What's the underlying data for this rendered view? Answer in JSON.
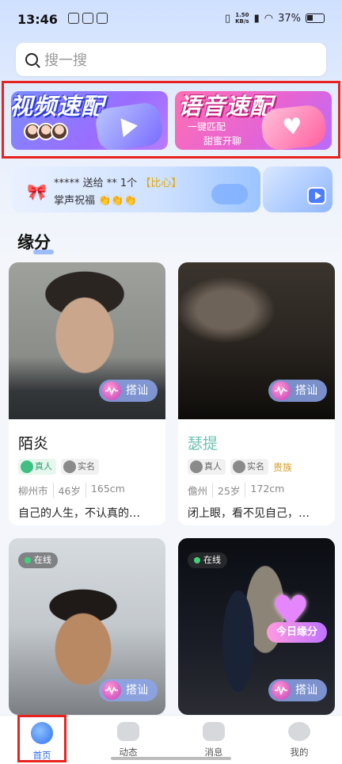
{
  "status_bar": {
    "time": "13:46",
    "net_speed": "1.50\nKB/s",
    "battery": "37%"
  },
  "search": {
    "placeholder": "搜一搜"
  },
  "banners": {
    "video": {
      "title": "视频速配"
    },
    "voice": {
      "title": "语音速配",
      "sub1": "一键匹配",
      "sub2": "甜蜜开聊"
    }
  },
  "ticker": {
    "line1_prefix": "***** 送给 ** 1个 ",
    "line1_gift": "【比心】",
    "line2": "掌声祝福 👏👏👏"
  },
  "section": {
    "title": "缘分"
  },
  "cards": [
    {
      "name": "陌炎",
      "tag_real": "真人",
      "tag_name": "实名",
      "city": "柳州市",
      "age": "46岁",
      "height": "165cm",
      "bio": "自己的人生，不认真的…",
      "chat_label": "搭讪"
    },
    {
      "name": "瑟提",
      "tag_real": "真人",
      "tag_name": "实名",
      "noble": "贵族",
      "city": "儋州",
      "age": "25岁",
      "height": "172cm",
      "bio": "闭上眼，看不见自己，…",
      "chat_label": "搭讪"
    },
    {
      "online": "在线",
      "chat_label": "搭讪"
    },
    {
      "online": "在线",
      "chat_label": "搭讪",
      "badge": "今日缘分"
    }
  ],
  "nav": [
    {
      "label": "首页",
      "icon": "home-planet-icon"
    },
    {
      "label": "动态",
      "icon": "moments-icon"
    },
    {
      "label": "消息",
      "icon": "message-icon"
    },
    {
      "label": "我的",
      "icon": "profile-icon"
    }
  ]
}
